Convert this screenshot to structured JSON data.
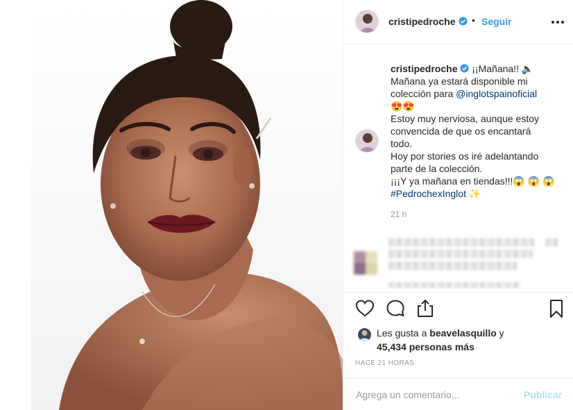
{
  "post": {
    "username": "cristipedroche",
    "follow_label": "Seguir",
    "separator": "•",
    "caption": {
      "username": "cristipedroche",
      "line1_text": "¡¡Mañana!! 🔈",
      "line2": "Mañana ya estará disponible mi",
      "line3_prefix": "colección para ",
      "mention": "@inglotspainoficial",
      "line4": "😍😍",
      "line5": "Estoy muy nerviosa, aunque estoy",
      "line6": "convencida de que os encantará",
      "line7": "todo.",
      "line8": "Hoy por stories os iré adelantando",
      "line9": "parte de la colección.",
      "line10": "¡¡¡Y ya mañana en tiendas!!!😱 😱 😱",
      "hashtag": "#PedrochexInglot",
      "hashtag_suffix": " ✨",
      "time": "21 h"
    },
    "likes": {
      "prefix": "Les gusta a ",
      "user": "beavelasquillo",
      "suffix": " y",
      "count_text": "45,434 personas más"
    },
    "timestamp": "HACE 21 HORAS",
    "comment_placeholder": "Agrega un comentario...",
    "publish_label": "Publicar",
    "icons": [
      "heart-icon",
      "comment-icon",
      "share-icon",
      "bookmark-icon",
      "more-icon",
      "verified-icon"
    ],
    "colors": {
      "accent": "#3897f0",
      "publish_disabled": "#b2dffc",
      "mention": "#003569",
      "muted": "#999999"
    }
  }
}
